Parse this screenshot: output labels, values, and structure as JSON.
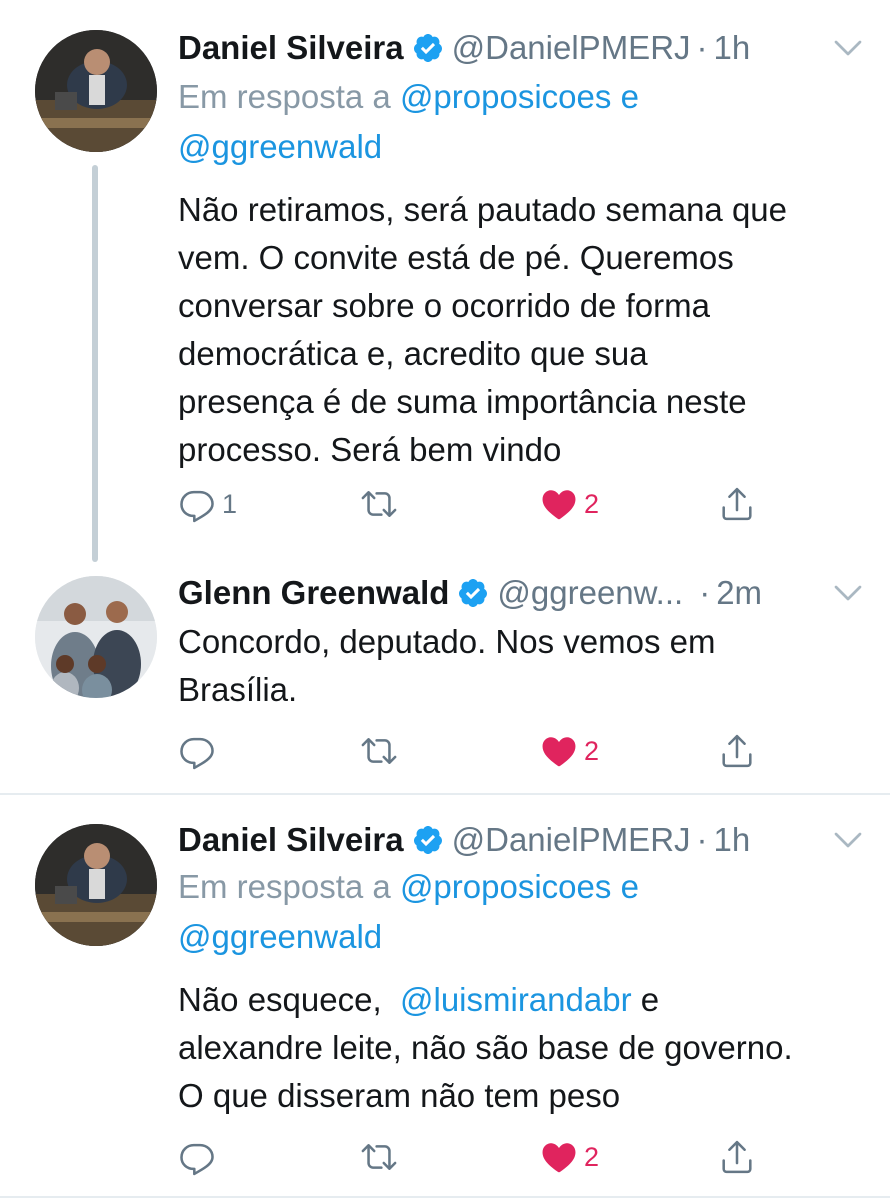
{
  "colors": {
    "accent": "#1b95e0",
    "like": "#e0245e",
    "secondary_text": "#657786",
    "divider": "#e6ecf0"
  },
  "tweets": [
    {
      "name": "Daniel Silveira",
      "handle": "@DanielPMERJ",
      "dot": "·",
      "time": "1h",
      "reply_prefix": "Em resposta a",
      "reply_mention_1": "@proposicoes",
      "reply_conj": "e",
      "reply_mention_2": "@ggreenwald",
      "text_lines": [
        "Não retiramos, será pautado semana que",
        "vem. O convite está de pé. Queremos",
        "conversar sobre o ocorrido de forma",
        "democrática e, acredito que sua",
        "presença é de suma importância neste",
        "processo. Será bem vindo"
      ],
      "reply_count": "1",
      "like_count": "2"
    },
    {
      "name": "Glenn Greenwald",
      "handle": "@ggreenw...",
      "dot": "·",
      "time": "2m",
      "text_lines": [
        "Concordo, deputado. Nos vemos em",
        "Brasília."
      ],
      "reply_count": "",
      "like_count": "2"
    },
    {
      "name": "Daniel Silveira",
      "handle": "@DanielPMERJ",
      "dot": "·",
      "time": "1h",
      "reply_prefix": "Em resposta a",
      "reply_mention_1": "@proposicoes",
      "reply_conj": "e",
      "reply_mention_2": "@ggreenwald",
      "text_line1_prefix": "Não esquece,",
      "text_line1_mention": "@luismirandabr",
      "text_line1_suffix": "e",
      "text_lines_rest": [
        "alexandre leite, não são base de governo.",
        "O que disseram não tem peso"
      ],
      "reply_count": "",
      "like_count": "2"
    }
  ],
  "icons": {
    "verified": "verified-badge-icon",
    "chevron": "chevron-down-icon",
    "reply": "reply-icon",
    "retweet": "retweet-icon",
    "like": "heart-icon",
    "share": "share-icon"
  }
}
